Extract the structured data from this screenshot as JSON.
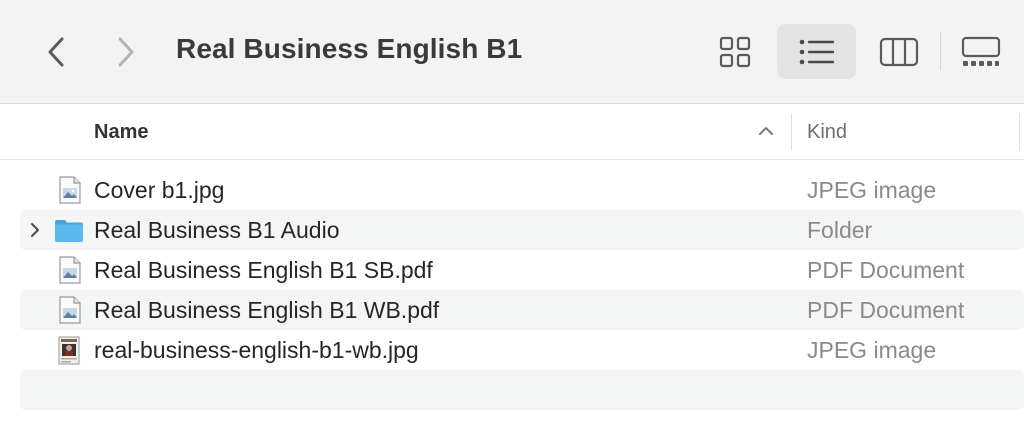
{
  "toolbar": {
    "title": "Real Business English B1",
    "back_icon": "chevron-left-icon",
    "forward_icon": "chevron-right-icon",
    "views": [
      {
        "name": "icon-view",
        "icon": "grid-icon",
        "selected": false
      },
      {
        "name": "list-view",
        "icon": "list-icon",
        "selected": true
      },
      {
        "name": "column-view",
        "icon": "columns-icon",
        "selected": false
      },
      {
        "name": "gallery-view",
        "icon": "gallery-icon",
        "selected": false
      }
    ]
  },
  "header": {
    "name": "Name",
    "kind": "Kind",
    "sort_direction": "ascending"
  },
  "files": [
    {
      "name": "Cover b1.jpg",
      "kind": "JPEG image",
      "icon": "image-file-icon",
      "folder": false
    },
    {
      "name": "Real Business B1 Audio",
      "kind": "Folder",
      "icon": "folder-icon",
      "folder": true
    },
    {
      "name": "Real Business English B1 SB.pdf",
      "kind": "PDF Document",
      "icon": "pdf-file-icon",
      "folder": false
    },
    {
      "name": "Real Business English B1 WB.pdf",
      "kind": "PDF Document",
      "icon": "pdf-file-icon",
      "folder": false
    },
    {
      "name": "real-business-english-b1-wb.jpg",
      "kind": "JPEG image",
      "icon": "image-thumbnail-icon",
      "folder": false
    }
  ],
  "colors": {
    "folder": "#5bb8ec",
    "toolbar_bg": "#f3f3f3",
    "row_alt": "#f4f5f5",
    "selected_view_bg": "#e3e3e3"
  }
}
